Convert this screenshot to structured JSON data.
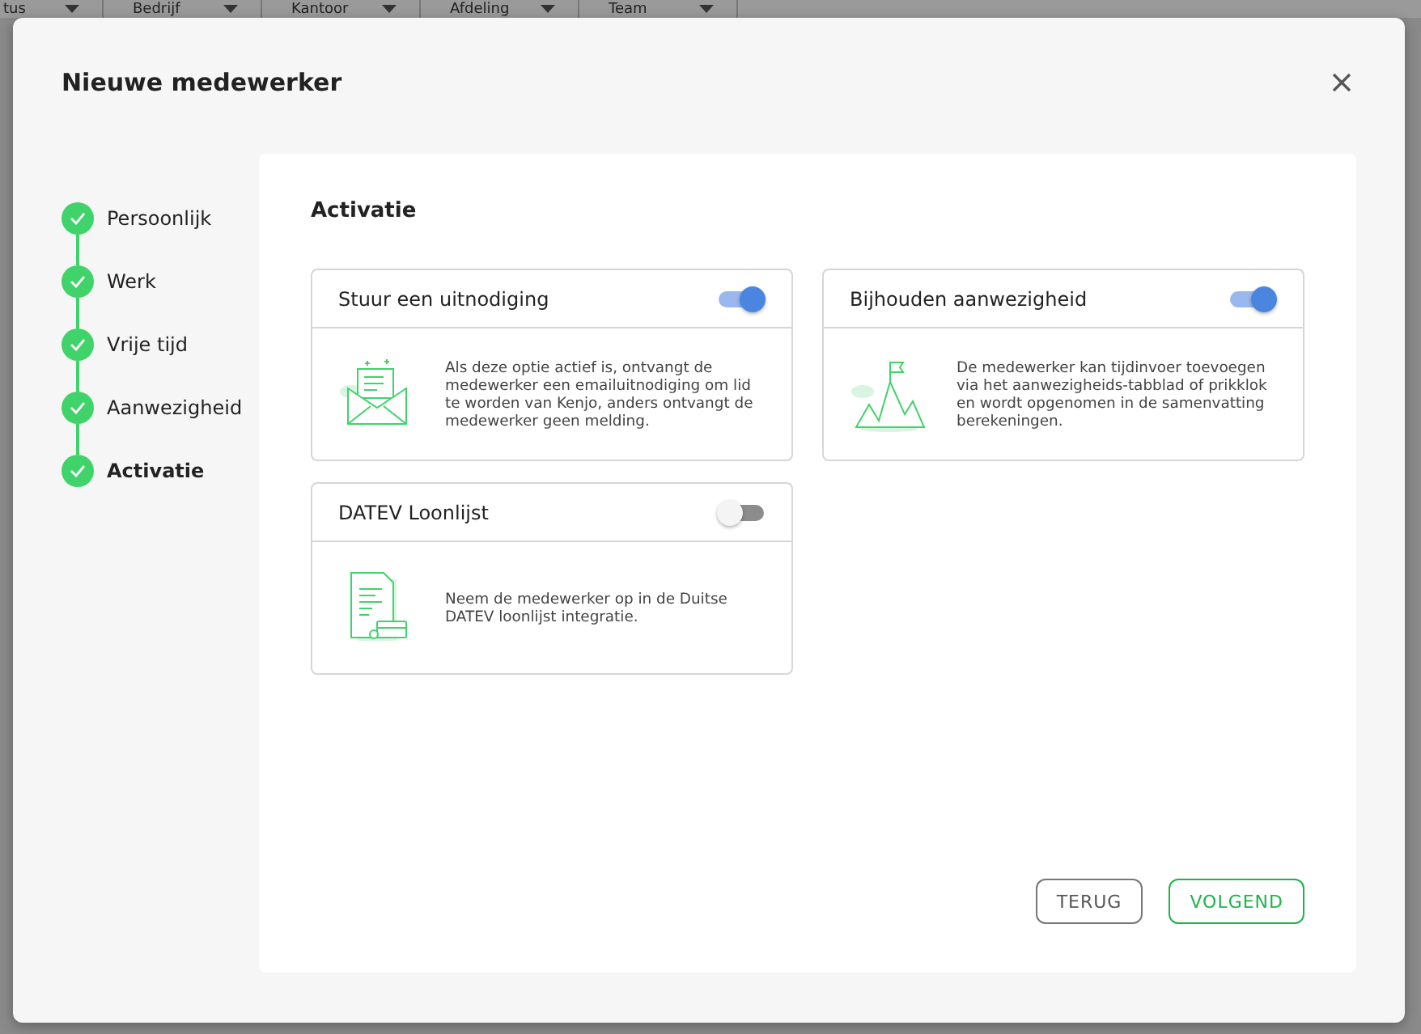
{
  "background_columns": [
    {
      "label": "tus"
    },
    {
      "label": "Bedrijf"
    },
    {
      "label": "Kantoor"
    },
    {
      "label": "Afdeling"
    },
    {
      "label": "Team"
    }
  ],
  "dialog": {
    "title": "Nieuwe medewerker",
    "steps": [
      {
        "label": "Persoonlijk",
        "completed": true,
        "selected": false
      },
      {
        "label": "Werk",
        "completed": true,
        "selected": false
      },
      {
        "label": "Vrije tijd",
        "completed": true,
        "selected": false
      },
      {
        "label": "Aanwezigheid",
        "completed": true,
        "selected": false
      },
      {
        "label": "Activatie",
        "completed": true,
        "selected": true
      }
    ],
    "section_title": "Activatie",
    "options": [
      {
        "kind": "envelope",
        "title": "Stuur een uitnodiging",
        "on": true,
        "description": "Als deze optie actief is, ontvangt de medewerker een emailuitnodiging om lid te worden van Kenjo, anders ontvangt de medewerker geen melding."
      },
      {
        "kind": "mountains",
        "title": "Bijhouden aanwezigheid",
        "on": true,
        "description": "De medewerker kan tijdinvoer toevoegen via het aanwezigheids-tabblad of prikklok en wordt opgenomen in de samenvatting berekeningen."
      },
      {
        "kind": "document",
        "title": "DATEV Loonlijst",
        "on": false,
        "description": "Neem de medewerker op in de Duitse DATEV loonlijst integratie."
      }
    ],
    "buttons": [
      {
        "label": "TERUG",
        "kind": "secondary"
      },
      {
        "label": "VOLGEND",
        "kind": "primary"
      }
    ]
  }
}
